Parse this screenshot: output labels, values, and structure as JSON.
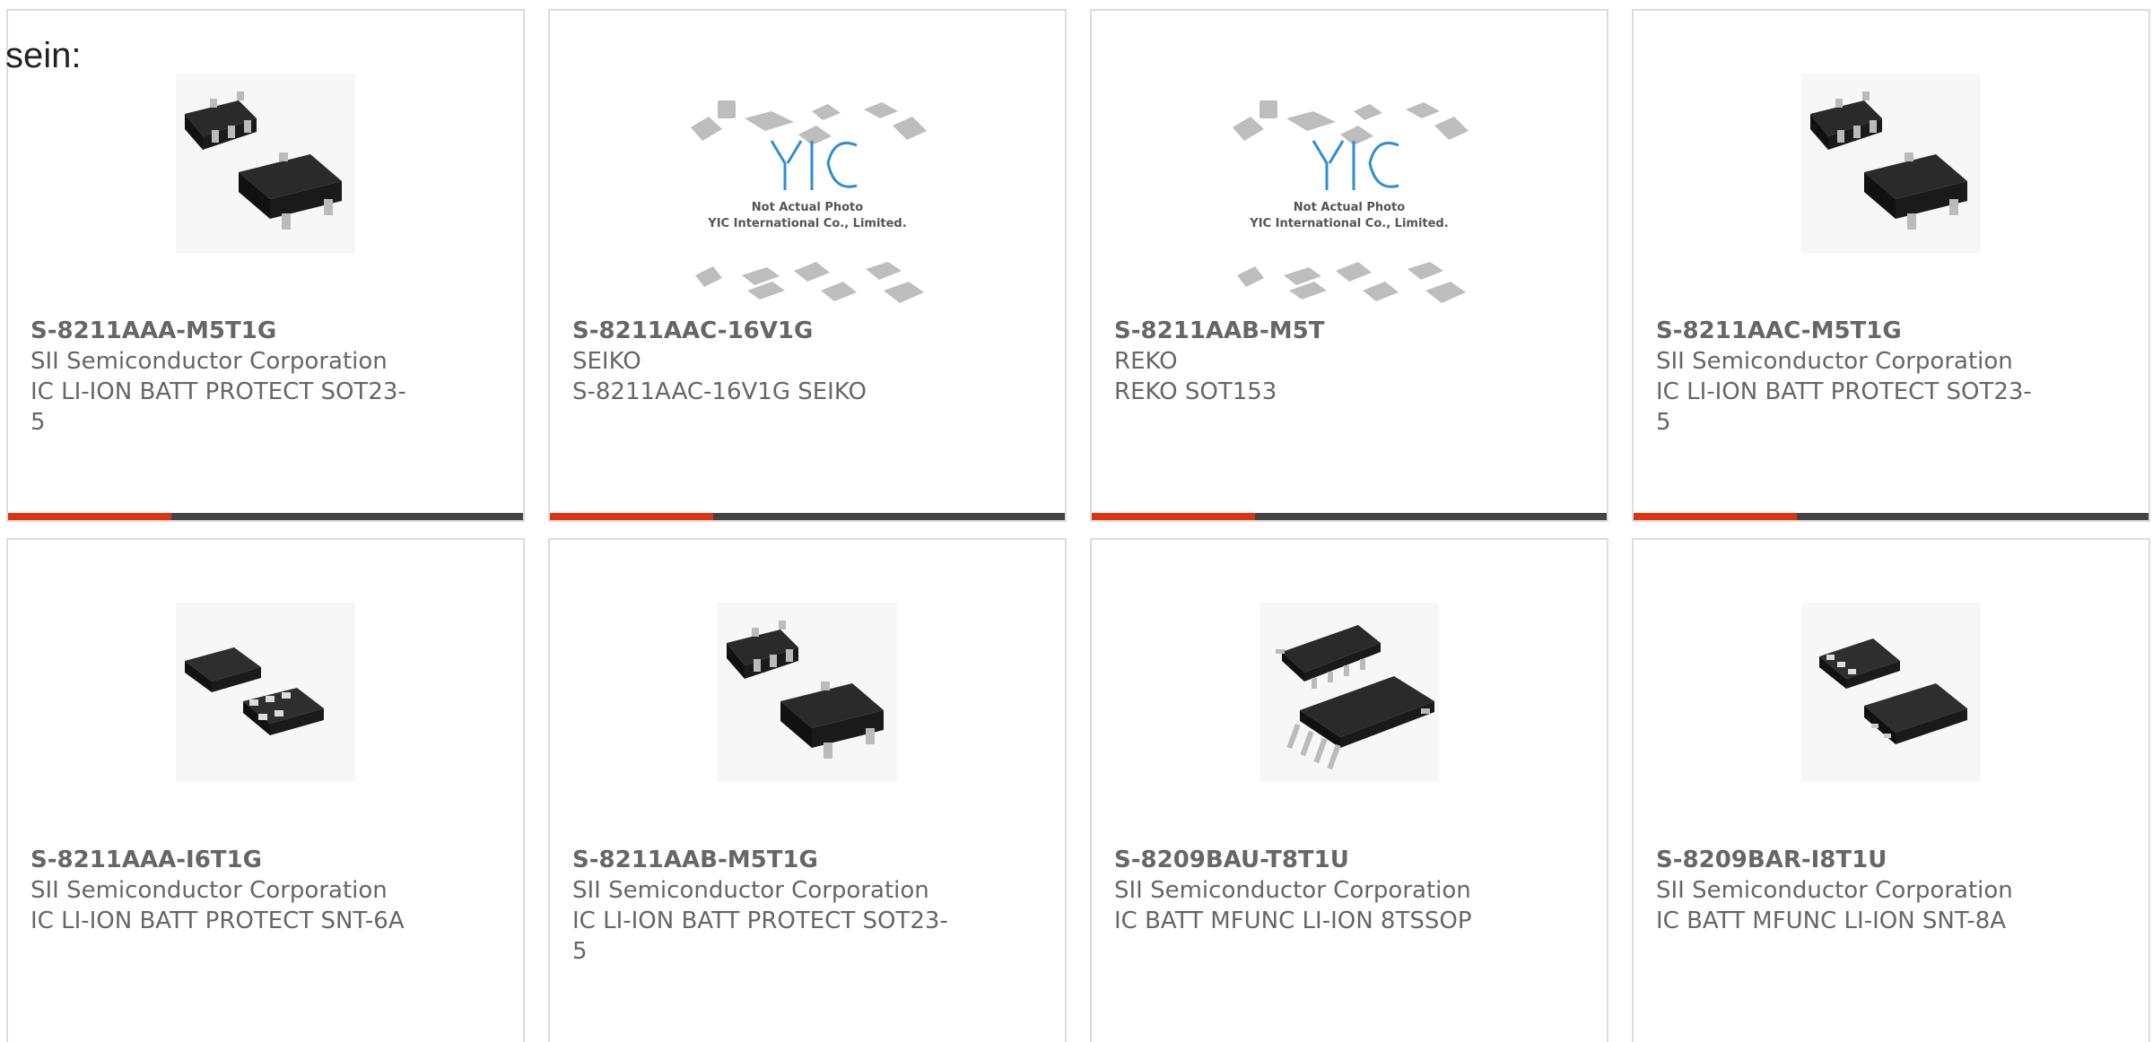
{
  "page": {
    "prefix_text": "sein:"
  },
  "colors": {
    "card_border": "#dcdcdc",
    "text": "#666666",
    "bar_dark": "#444444",
    "bar_accent": "#dd3311"
  },
  "products": [
    {
      "part": "S-8211AAA-M5T1G",
      "manufacturer": "SII Semiconductor Corporation",
      "description": "IC LI-ION BATT PROTECT SOT23-5",
      "image": "sot23-5-package-icon"
    },
    {
      "part": "S-8211AAC-16V1G",
      "manufacturer": "SEIKO",
      "description": "S-8211AAC-16V1G SEIKO",
      "image": "yic-placeholder-icon",
      "image_text": [
        "Not Actual Photo",
        "YIC International Co., Limited."
      ]
    },
    {
      "part": "S-8211AAB-M5T",
      "manufacturer": "REKO",
      "description": "REKO SOT153",
      "image": "yic-placeholder-icon",
      "image_text": [
        "Not Actual Photo",
        "YIC International Co., Limited."
      ]
    },
    {
      "part": "S-8211AAC-M5T1G",
      "manufacturer": "SII Semiconductor Corporation",
      "description": "IC LI-ION BATT PROTECT SOT23-5",
      "image": "sot23-5-package-icon"
    },
    {
      "part": "S-8211AAA-I6T1G",
      "manufacturer": "SII Semiconductor Corporation",
      "description": "IC LI-ION BATT PROTECT SNT-6A",
      "image": "snt-6a-package-icon"
    },
    {
      "part": "S-8211AAB-M5T1G",
      "manufacturer": "SII Semiconductor Corporation",
      "description": "IC LI-ION BATT PROTECT SOT23-5",
      "image": "sot23-5-package-icon"
    },
    {
      "part": "S-8209BAU-T8T1U",
      "manufacturer": "SII Semiconductor Corporation",
      "description": "IC BATT MFUNC LI-ION 8TSSOP",
      "image": "tssop-8-package-icon"
    },
    {
      "part": "S-8209BAR-I8T1U",
      "manufacturer": "SII Semiconductor Corporation",
      "description": "IC BATT MFUNC LI-ION SNT-8A",
      "image": "snt-8a-package-icon"
    }
  ]
}
